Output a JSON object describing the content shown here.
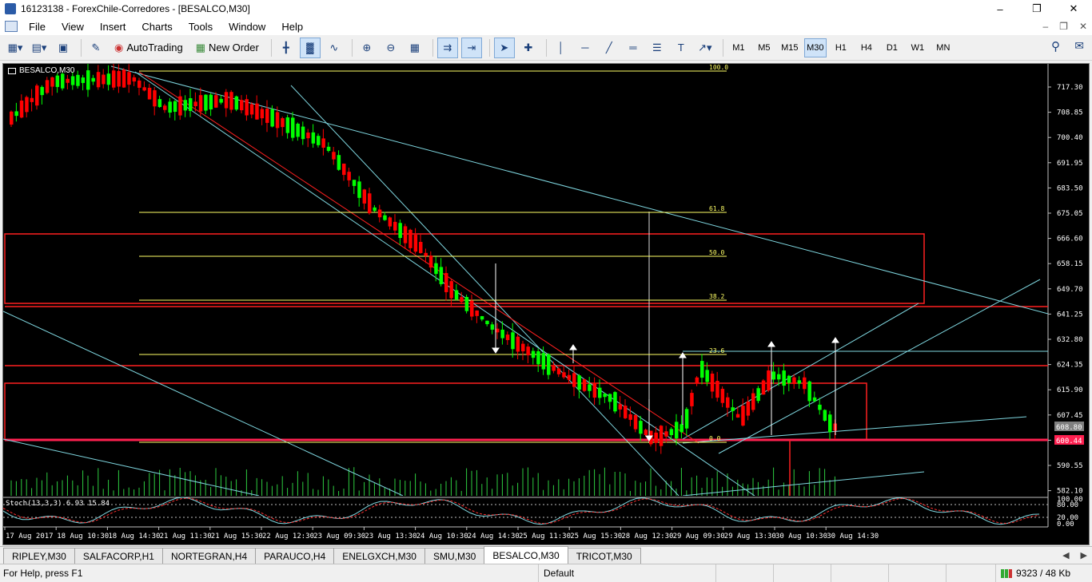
{
  "window": {
    "title": "16123138 - ForexChile-Corredores - [BESALCO,M30]"
  },
  "menu": [
    "File",
    "View",
    "Insert",
    "Charts",
    "Tools",
    "Window",
    "Help"
  ],
  "toolbar": {
    "autotrading": "AutoTrading",
    "new_order": "New Order",
    "timeframes": [
      "M1",
      "M5",
      "M15",
      "M30",
      "H1",
      "H4",
      "D1",
      "W1",
      "MN"
    ],
    "active_timeframe": "M30"
  },
  "chart": {
    "label": "BESALCO,M30",
    "price_ticks": [
      "717.30",
      "708.85",
      "700.40",
      "691.95",
      "683.50",
      "675.05",
      "666.60",
      "658.15",
      "649.70",
      "641.25",
      "632.80",
      "624.35",
      "615.90",
      "607.45",
      "599.00",
      "590.55",
      "582.10"
    ],
    "time_ticks": [
      "17 Aug 2017",
      "18 Aug 10:30",
      "18 Aug 14:30",
      "21 Aug 11:30",
      "21 Aug 15:30",
      "22 Aug 12:30",
      "23 Aug 09:30",
      "23 Aug 13:30",
      "24 Aug 10:30",
      "24 Aug 14:30",
      "25 Aug 11:30",
      "25 Aug 15:30",
      "28 Aug 12:30",
      "29 Aug 09:30",
      "29 Aug 13:30",
      "30 Aug 10:30",
      "30 Aug 14:30"
    ],
    "fib_levels": [
      "100.0",
      "61.8",
      "50.0",
      "38.2",
      "23.6",
      "0.0"
    ],
    "price_label_gray": "608.80",
    "price_label_red": "600.44",
    "stoch_label": "Stoch(13,3,3) 6.93 15.84",
    "stoch_ticks": [
      "100.00",
      "80.00",
      "20.00",
      "0.00"
    ]
  },
  "tabs": [
    "RIPLEY,M30",
    "SALFACORP,H1",
    "NORTEGRAN,H4",
    "PARAUCO,H4",
    "ENELGXCH,M30",
    "SMU,M30",
    "BESALCO,M30",
    "TRICOT,M30"
  ],
  "active_tab": "BESALCO,M30",
  "status": {
    "help": "For Help, press F1",
    "profile": "Default",
    "traffic": "9323 / 48 Kb"
  },
  "colors": {
    "bull": "#00ff00",
    "bear": "#ff0000",
    "fib": "#ffff66",
    "trend": "#7fd7e0",
    "zone": "#ff2020",
    "bg": "#000000"
  }
}
